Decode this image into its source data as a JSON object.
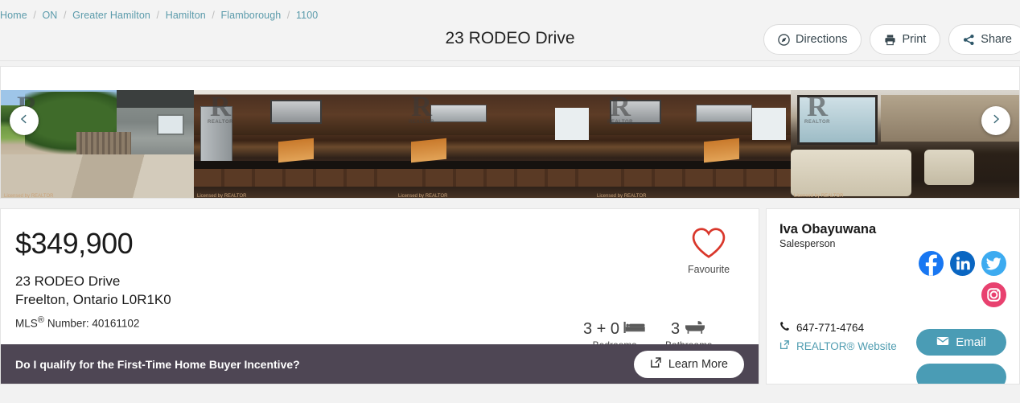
{
  "header": {
    "breadcrumb": [
      {
        "label": "Home"
      },
      {
        "label": "ON"
      },
      {
        "label": "Greater Hamilton"
      },
      {
        "label": "Hamilton"
      },
      {
        "label": "Flamborough"
      },
      {
        "label": "1100"
      }
    ],
    "separator": "/",
    "title": "23 RODEO Drive",
    "actions": [
      {
        "label": "Directions",
        "icon": "compass-icon"
      },
      {
        "label": "Print",
        "icon": "printer-icon"
      },
      {
        "label": "Share",
        "icon": "share-icon"
      }
    ]
  },
  "gallery": {
    "prev_icon": "chevron-left-icon",
    "next_icon": "chevron-right-icon",
    "watermark": "REALTOR",
    "watermark_letter": "R",
    "credit": "Licensed by REALTOR",
    "photos": [
      {
        "alt": "backyard-patio"
      },
      {
        "alt": "kitchen-1"
      },
      {
        "alt": "kitchen-2"
      },
      {
        "alt": "kitchen-3"
      },
      {
        "alt": "living-room"
      }
    ]
  },
  "listing": {
    "price": "$349,900",
    "address_line1": "23 RODEO Drive",
    "address_line2": "Freelton, Ontario L0R1K0",
    "mls_label": "MLS",
    "mls_sup": "®",
    "mls_number": " Number: 40161102",
    "favourite_label": "Favourite",
    "favourite_icon": "heart-icon",
    "favourite_color": "#d9372b",
    "bedrooms": {
      "value": "3 + 0",
      "label": "Bedrooms",
      "icon": "bed-icon"
    },
    "bathrooms": {
      "value": "3",
      "label": "Bathrooms",
      "icon": "bathtub-icon"
    }
  },
  "incentive": {
    "text": "Do I qualify for the First-Time Home Buyer Incentive?",
    "button_label": "Learn More",
    "button_icon": "external-link-icon",
    "background": "#4e4654"
  },
  "agent": {
    "name": "Iva Obayuwana",
    "role": "Salesperson",
    "socials": [
      {
        "name": "facebook-icon",
        "glyph": "f",
        "color": "#1877f2"
      },
      {
        "name": "linkedin-icon",
        "glyph": "in",
        "color": "#0a66c2"
      },
      {
        "name": "twitter-icon",
        "glyph": "✈",
        "color": "#3dabf0"
      },
      {
        "name": "instagram-icon",
        "glyph": "◎",
        "color": "#e8416f"
      }
    ],
    "phone": "647-771-4764",
    "phone_icon": "phone-icon",
    "website_label": "REALTOR® Website",
    "website_icon": "external-link-icon",
    "email_label": "Email",
    "email_icon": "envelope-icon",
    "email_color": "#4a9cb5"
  }
}
